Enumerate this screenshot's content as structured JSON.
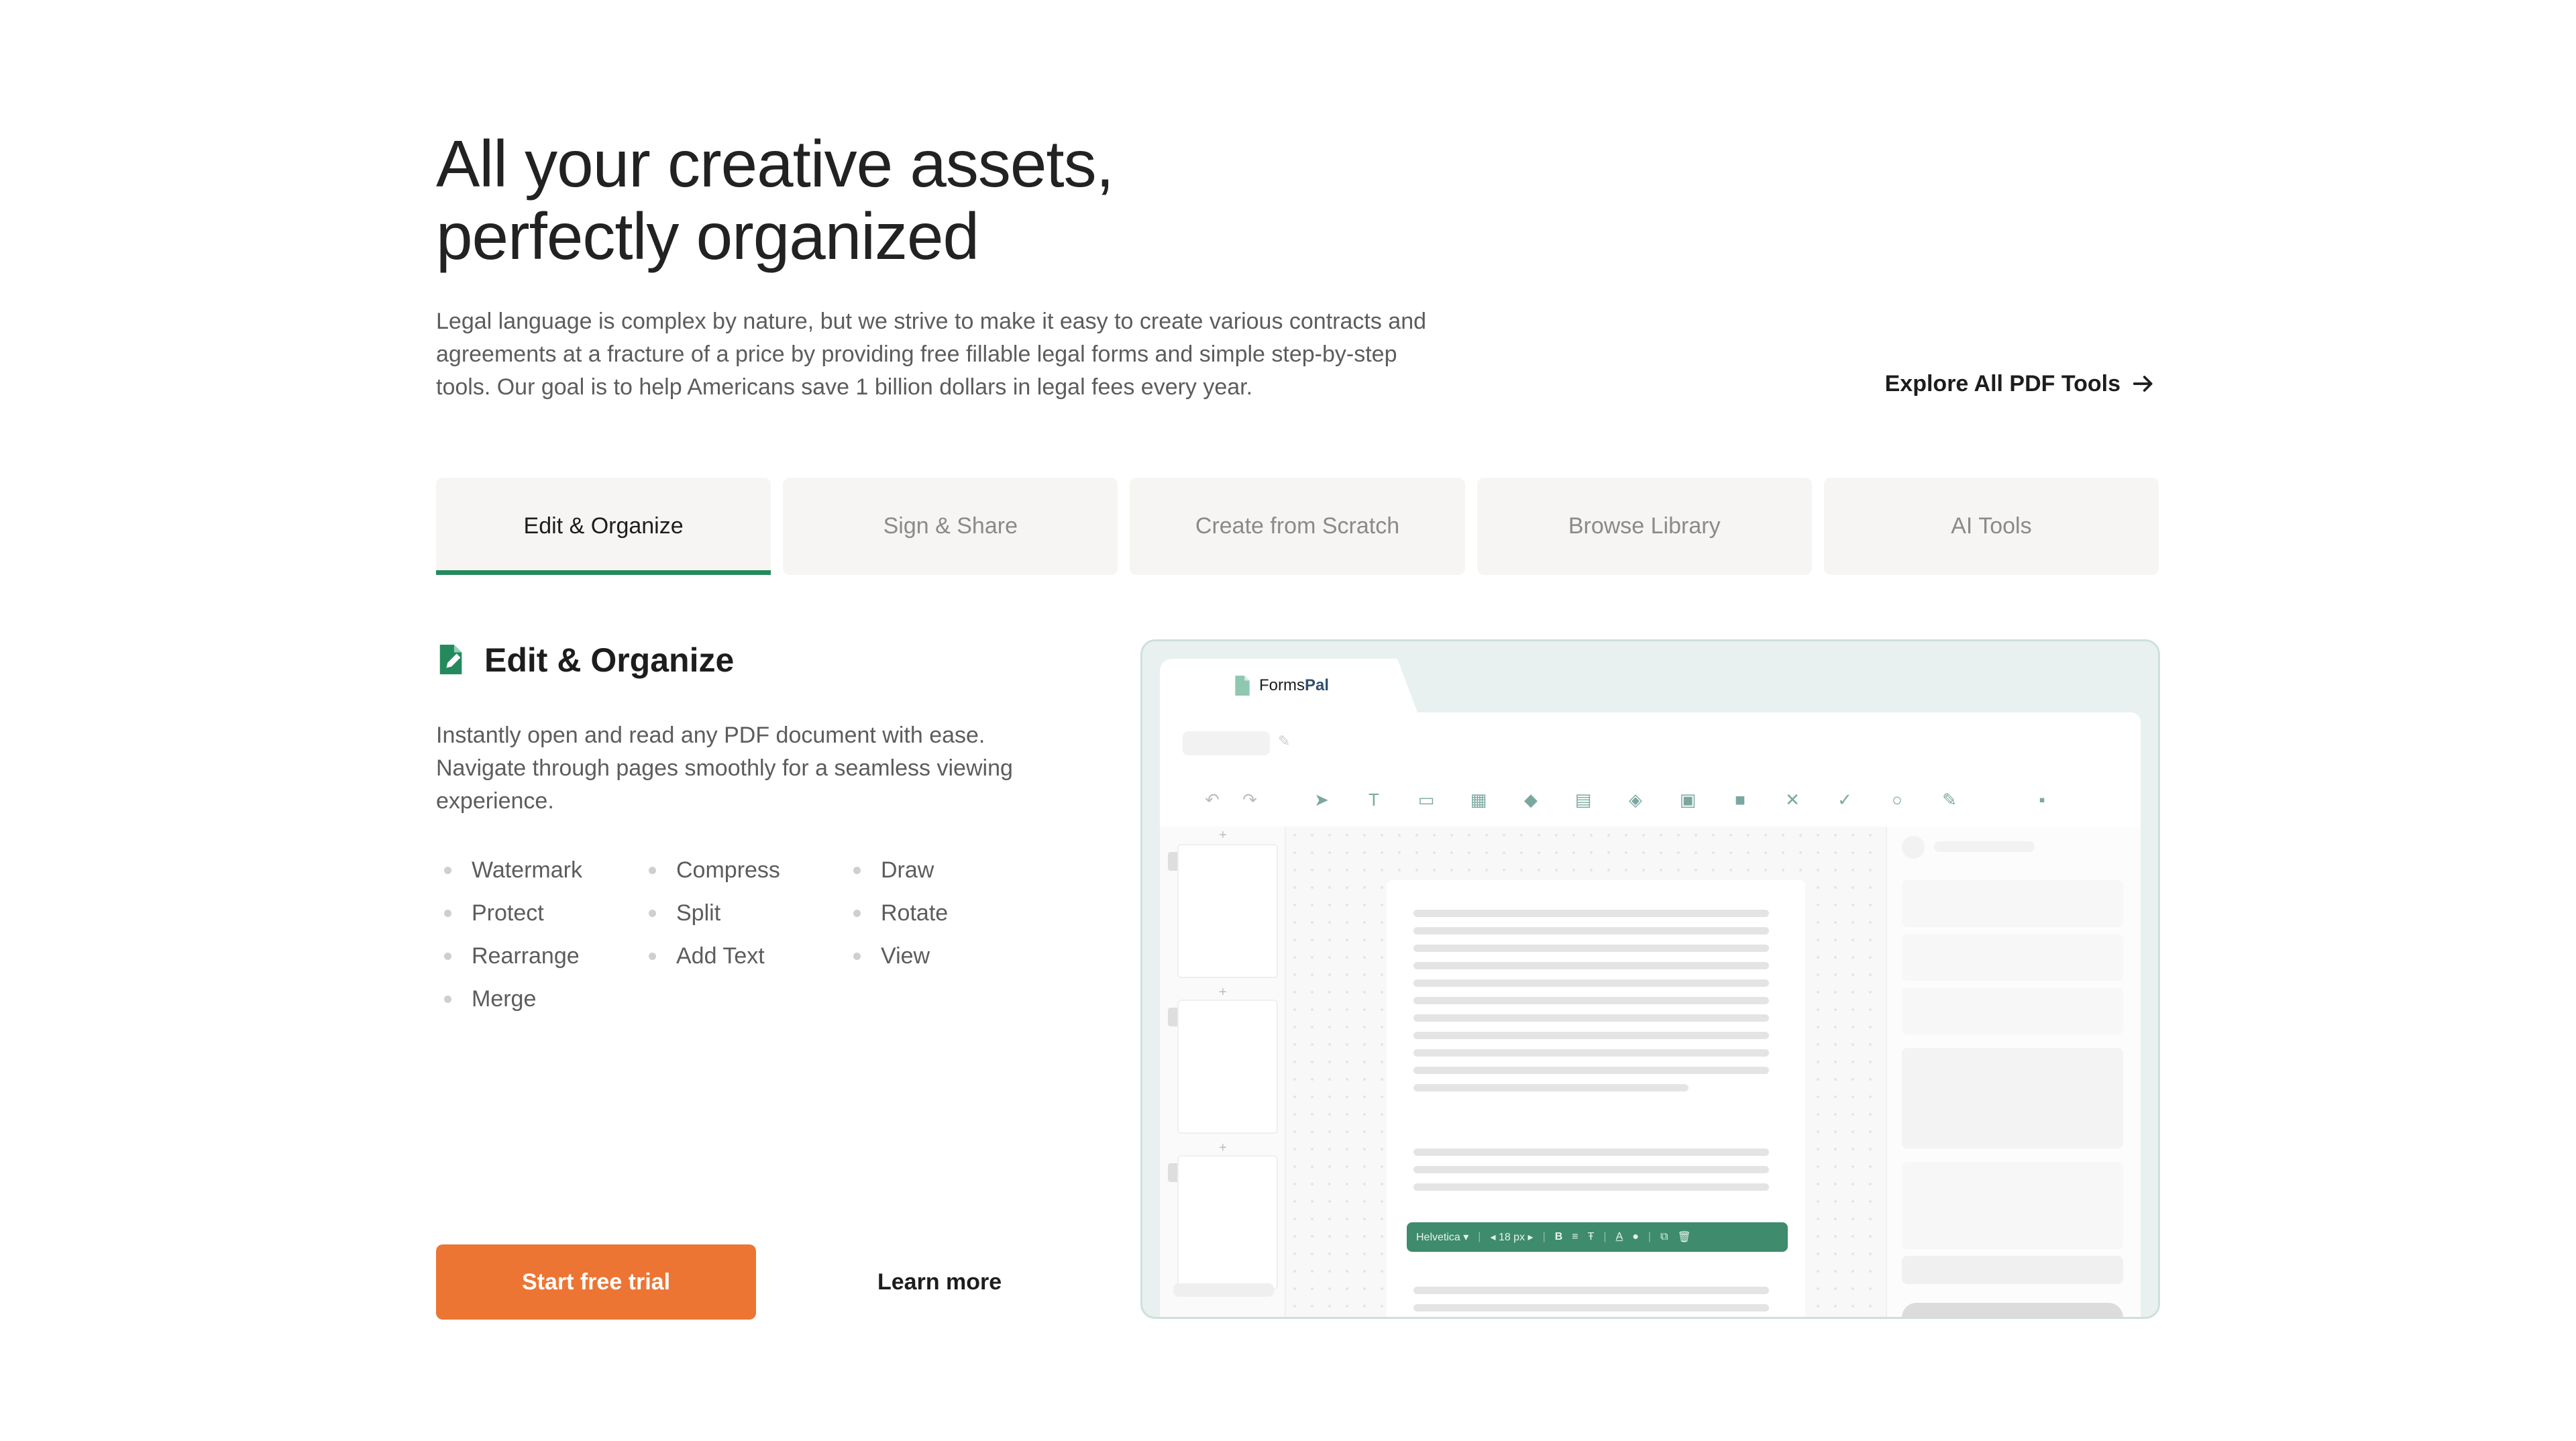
{
  "hero": {
    "title_line1": "All your creative assets,",
    "title_line2": "perfectly organized",
    "description": "Legal language is complex by nature, but we strive to make it easy to create various contracts and agreements at a fracture of a price by providing free fillable legal forms and simple step-by-step tools. Our goal is to help Americans save 1 billion dollars in legal fees every year.",
    "explore_label": "Explore All PDF Tools"
  },
  "tabs": [
    {
      "label": "Edit & Organize",
      "active": true
    },
    {
      "label": "Sign & Share",
      "active": false
    },
    {
      "label": "Create from Scratch",
      "active": false
    },
    {
      "label": "Browse Library",
      "active": false
    },
    {
      "label": "AI Tools",
      "active": false
    }
  ],
  "section": {
    "title": "Edit & Organize",
    "description": "Instantly open and read any PDF document with ease. Navigate through pages smoothly for a seamless viewing experience.",
    "features": [
      "Watermark",
      "Protect",
      "Rearrange",
      "Merge",
      "Compress",
      "Split",
      "Add Text",
      "Draw",
      "Rotate",
      "View"
    ],
    "cta_primary": "Start free trial",
    "cta_secondary": "Learn more"
  },
  "mockup": {
    "app_name_a": "Forms",
    "app_name_b": "Pal",
    "font_name": "Helvetica",
    "font_size": "18 px",
    "bold_label": "B",
    "color_label": "A"
  },
  "colors": {
    "accent_green": "#248a5e",
    "cta_orange": "#ec7534",
    "mock_toolbar_green": "#3f8b6e"
  }
}
